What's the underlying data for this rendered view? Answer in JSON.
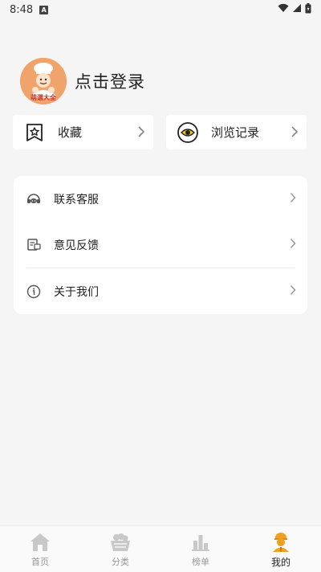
{
  "status_bar": {
    "time": "8:48",
    "notification_letter": "A"
  },
  "profile": {
    "login_label": "点击登录",
    "avatar_text": "萌谱大全"
  },
  "quick_actions": [
    {
      "label": "收藏",
      "icon": "star-box-icon"
    },
    {
      "label": "浏览记录",
      "icon": "eye-icon"
    }
  ],
  "menu": [
    {
      "label": "联系客服",
      "icon": "headset-icon"
    },
    {
      "label": "意见反馈",
      "icon": "feedback-icon"
    },
    {
      "label": "关于我们",
      "icon": "info-icon"
    }
  ],
  "tabs": [
    {
      "label": "首页",
      "icon": "home-icon",
      "active": false
    },
    {
      "label": "分类",
      "icon": "basket-icon",
      "active": false
    },
    {
      "label": "榜单",
      "icon": "ranking-icon",
      "active": false
    },
    {
      "label": "我的",
      "icon": "profile-icon",
      "active": true
    }
  ],
  "colors": {
    "accent": "#f1a36c",
    "tab_active": "#f0a020",
    "tab_inactive": "#c8c8c8"
  }
}
